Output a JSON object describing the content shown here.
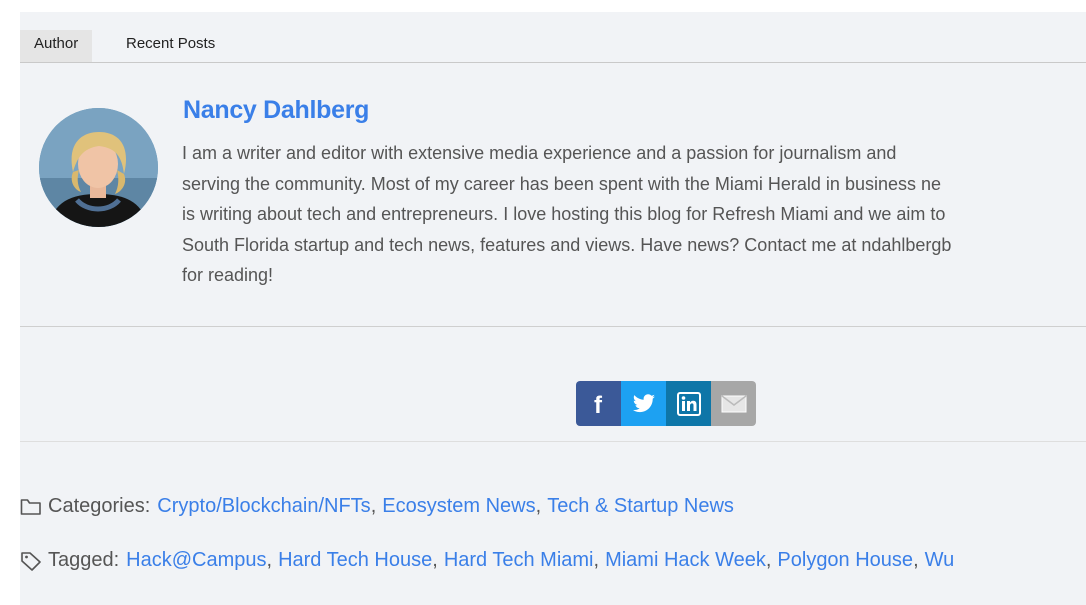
{
  "tabs": [
    "Author",
    "Recent Posts"
  ],
  "author": {
    "name": "Nancy Dahlberg",
    "bio_lines": [
      "I am a writer and editor with extensive media experience and a passion for journalism and",
      "serving the community. Most of my career has been spent with the Miami Herald in business ne",
      "is writing about tech and entrepreneurs. I love hosting this blog for Refresh Miami and we aim to",
      "South Florida startup and tech news, features and views. Have news? Contact me at ndahlbergb",
      "for reading!"
    ]
  },
  "share": {
    "buttons": [
      {
        "name": "facebook",
        "glyph": "f"
      },
      {
        "name": "twitter",
        "glyph": "twitter-bird"
      },
      {
        "name": "linkedin",
        "glyph": "in"
      },
      {
        "name": "email",
        "glyph": "envelope"
      }
    ]
  },
  "categories": {
    "label": "Categories:",
    "items": [
      "Crypto/Blockchain/NFTs",
      "Ecosystem News",
      "Tech & Startup News"
    ]
  },
  "tags": {
    "label": "Tagged:",
    "items": [
      "Hack@Campus",
      "Hard Tech House",
      "Hard Tech Miami",
      "Miami Hack Week",
      "Polygon House",
      "Wu"
    ]
  },
  "colors": {
    "link": "#3a7fe8",
    "facebook": "#3b5998",
    "twitter": "#1da1f2",
    "linkedin": "#0e76a8",
    "email": "#a7a7a7"
  }
}
